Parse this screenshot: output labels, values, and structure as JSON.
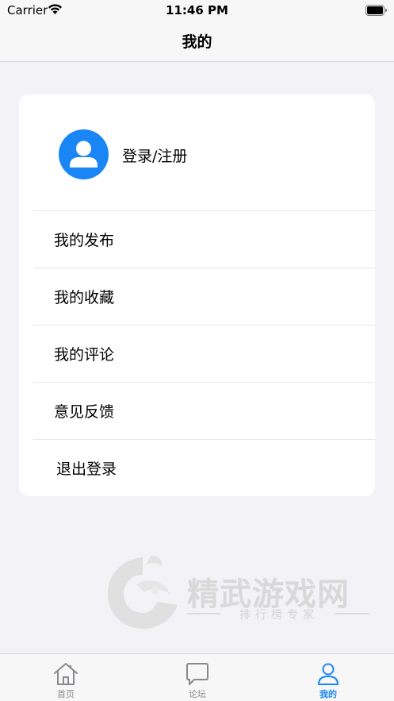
{
  "status_bar": {
    "carrier": "Carrier",
    "time": "11:46 PM"
  },
  "nav": {
    "title": "我的"
  },
  "profile": {
    "login_label": "登录/注册",
    "avatar_icon": "person-icon"
  },
  "menu": {
    "items": [
      {
        "label": "我的发布"
      },
      {
        "label": "我的收藏"
      },
      {
        "label": "我的评论"
      },
      {
        "label": "意见反馈"
      },
      {
        "label": "退出登录"
      }
    ]
  },
  "watermark": {
    "title": "精武游戏网",
    "subtitle": "排行榜专家"
  },
  "tabs": [
    {
      "label": "首页",
      "icon": "home-icon",
      "active": false
    },
    {
      "label": "论坛",
      "icon": "chat-bubble-icon",
      "active": false
    },
    {
      "label": "我的",
      "icon": "person-icon",
      "active": true
    }
  ],
  "colors": {
    "accent": "#1a86f5",
    "background": "#f2f2f7",
    "card": "#ffffff",
    "inactive_tab": "#8a8a8e"
  }
}
